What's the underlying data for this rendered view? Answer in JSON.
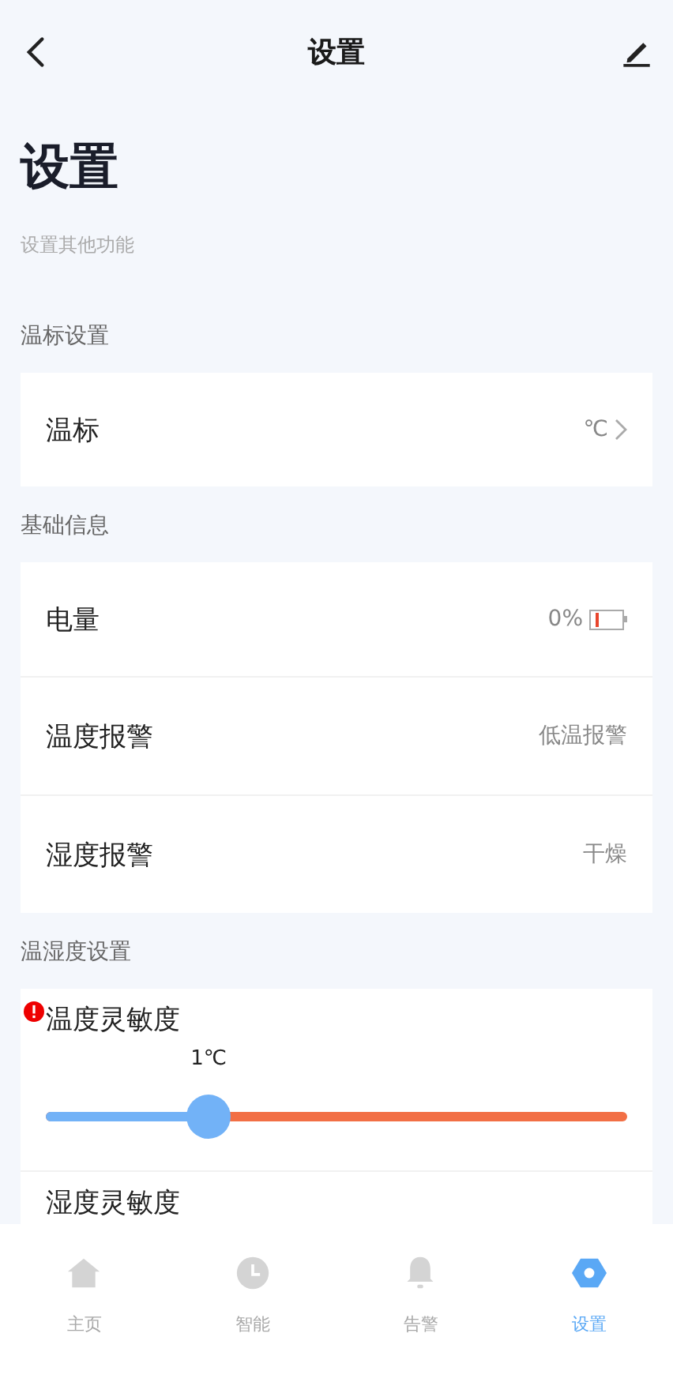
{
  "header": {
    "title": "设置"
  },
  "page": {
    "title": "设置",
    "subtitle": "设置其他功能"
  },
  "sections": [
    {
      "title": "温标设置",
      "rows": [
        {
          "kind": "link",
          "label": "温标",
          "value": "℃"
        }
      ]
    },
    {
      "title": "基础信息",
      "rows": [
        {
          "kind": "battery",
          "label": "电量",
          "value": "0%"
        },
        {
          "kind": "text",
          "label": "温度报警",
          "value": "低温报警"
        },
        {
          "kind": "text",
          "label": "湿度报警",
          "value": "干燥"
        }
      ]
    },
    {
      "title": "温湿度设置",
      "rows": [
        {
          "kind": "slider",
          "label": "温度灵敏度",
          "warning": true,
          "reading": "1℃",
          "level": 0.28
        },
        {
          "kind": "slider",
          "label": "湿度灵敏度",
          "warning": false
        }
      ]
    }
  ],
  "tabs": [
    {
      "label": "主页",
      "selected": false
    },
    {
      "label": "智能",
      "selected": false
    },
    {
      "label": "告警",
      "selected": false
    },
    {
      "label": "设置",
      "selected": true
    }
  ]
}
